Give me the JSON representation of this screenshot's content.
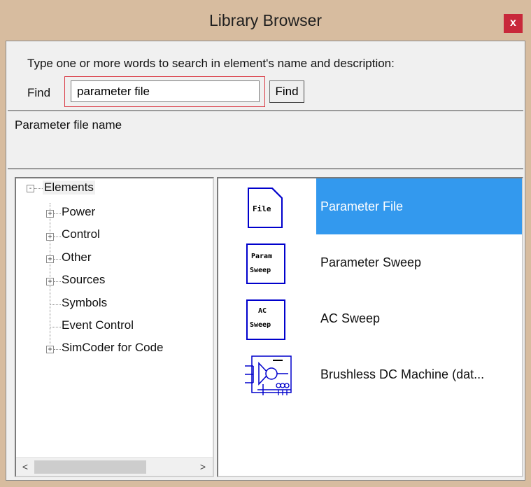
{
  "window": {
    "title": "Library Browser",
    "close_glyph": "x"
  },
  "search": {
    "instruction": "Type one or more words to search in element's name and  description:",
    "find_label": "Find",
    "input_value": "parameter file",
    "find_button": "Find"
  },
  "description": {
    "text": "Parameter file name"
  },
  "tree": {
    "root": {
      "label": "Elements",
      "expander": "-"
    },
    "items": [
      {
        "label": "Power",
        "expander": "+"
      },
      {
        "label": "Control",
        "expander": "+"
      },
      {
        "label": "Other",
        "expander": "+"
      },
      {
        "label": "Sources",
        "expander": "+"
      },
      {
        "label": "Symbols",
        "expander": ""
      },
      {
        "label": "Event Control",
        "expander": ""
      },
      {
        "label": "SimCoder for Code",
        "expander": "+"
      }
    ],
    "scroll_left": "<",
    "scroll_right": ">"
  },
  "results": {
    "items": [
      {
        "label": "Parameter File",
        "icon": "parameter-file-icon",
        "icon_text": [
          "File"
        ],
        "selected": true
      },
      {
        "label": "Parameter Sweep",
        "icon": "parameter-sweep-icon",
        "icon_text": [
          "Param",
          "Sweep"
        ],
        "selected": false
      },
      {
        "label": "AC Sweep",
        "icon": "ac-sweep-icon",
        "icon_text": [
          "AC",
          "Sweep"
        ],
        "selected": false
      },
      {
        "label": "Brushless DC Machine (dat...",
        "icon": "brushless-dc-machine-icon",
        "icon_text": [],
        "selected": false
      }
    ]
  },
  "colors": {
    "title_bar": "#d7bc9f",
    "close_button": "#c8283a",
    "selection": "#3399ee",
    "search_highlight": "#d9343f",
    "icon_stroke": "#0000cc"
  }
}
